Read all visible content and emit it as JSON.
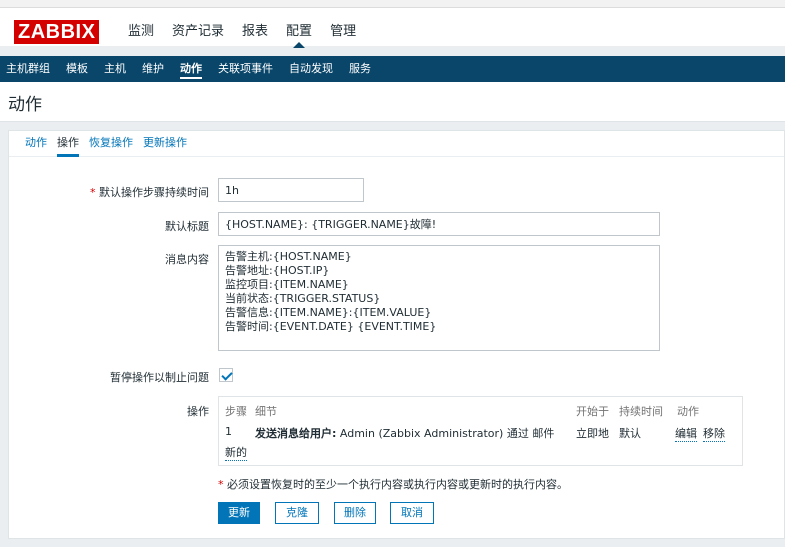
{
  "brand": {
    "logo": "ZABBIX",
    "logo_color": "#d40000"
  },
  "main_menu": [
    "监测",
    "资产记录",
    "报表",
    "配置",
    "管理"
  ],
  "main_menu_active": "配置",
  "sub_menu": [
    "主机群组",
    "模板",
    "主机",
    "维护",
    "动作",
    "关联项事件",
    "自动发现",
    "服务"
  ],
  "sub_menu_active": "动作",
  "page_title": "动作",
  "tabs": [
    "动作",
    "操作",
    "恢复操作",
    "更新操作"
  ],
  "tab_active": "操作",
  "form": {
    "step_duration_label": "默认操作步骤持续时间",
    "step_duration_value": "1h",
    "subject_label": "默认标题",
    "subject_value": "{HOST.NAME}: {TRIGGER.NAME}故障!",
    "message_label": "消息内容",
    "message_value": "告警主机:{HOST.NAME}\n告警地址:{HOST.IP}\n监控项目:{ITEM.NAME}\n当前状态:{TRIGGER.STATUS}\n告警信息:{ITEM.NAME}:{ITEM.VALUE}\n告警时间:{EVENT.DATE} {EVENT.TIME}",
    "pause_label": "暂停操作以制止问题",
    "pause_checked": true,
    "operations_label": "操作"
  },
  "operations_table": {
    "headers": {
      "step": "步骤",
      "detail": "细节",
      "start": "开始于",
      "duration": "持续时间",
      "action": "动作"
    },
    "rows": [
      {
        "step": "1",
        "detail_bold": "发送消息给用户:",
        "detail_rest": " Admin (Zabbix Administrator) 通过 邮件",
        "start": "立即地",
        "duration": "默认",
        "edit": "编辑",
        "remove": "移除"
      }
    ],
    "new_link": "新的"
  },
  "note": "必须设置恢复时的至少一个执行内容或执行内容或更新时的执行内容。",
  "buttons": {
    "update": "更新",
    "clone": "克隆",
    "delete": "删除",
    "cancel": "取消"
  },
  "colors": {
    "nav_bg": "#0a466a",
    "link": "#0275b8",
    "required": "#d40000"
  }
}
